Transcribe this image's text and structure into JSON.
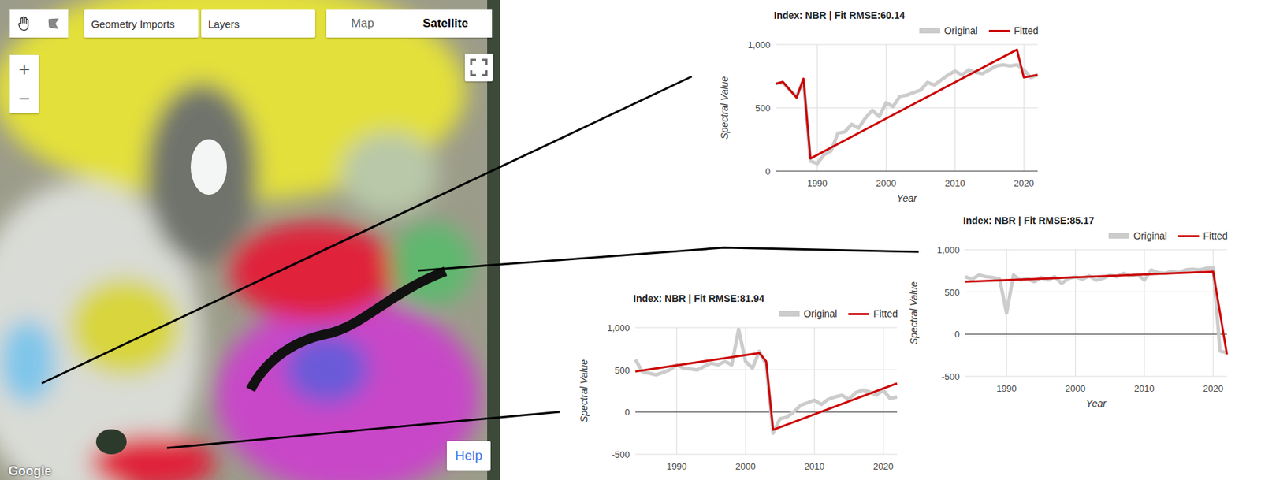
{
  "map": {
    "geometry_imports": "Geometry Imports",
    "layers": "Layers",
    "map_types": [
      {
        "label": "Map",
        "selected": false
      },
      {
        "label": "Satellite",
        "selected": true
      }
    ],
    "zoom": [
      "+",
      "−"
    ],
    "help": "Help",
    "attribution": "Google"
  },
  "charts": [
    {
      "title": "Index: NBR | Fit RMSE:60.14",
      "legend": {
        "original": "Original",
        "fitted": "Fitted"
      },
      "y_label": "Spectral Value",
      "x_label": "Year",
      "y_min": 0,
      "y_max": 1000,
      "y_ticks": [
        {
          "label": "0",
          "value": 0
        },
        {
          "label": "500",
          "value": 500
        },
        {
          "label": "1,000",
          "value": 1000
        }
      ],
      "x_ticks": [
        {
          "label": "1990",
          "value": 1990
        },
        {
          "label": "2000",
          "value": 2000
        },
        {
          "label": "2010",
          "value": 2010
        },
        {
          "label": "2020",
          "value": 2020
        }
      ],
      "original": {
        "start_year": 1984,
        "values": [
          690,
          700,
          640,
          590,
          720,
          80,
          60,
          130,
          160,
          300,
          310,
          370,
          340,
          420,
          480,
          430,
          540,
          510,
          590,
          600,
          620,
          640,
          700,
          680,
          720,
          760,
          790,
          760,
          800,
          780,
          770,
          800,
          830,
          840,
          830,
          840,
          800,
          740,
          760
        ]
      },
      "fitted": {
        "years": [
          1984,
          1985,
          1987,
          1988,
          1989,
          2019,
          2020,
          2022
        ],
        "values": [
          690,
          705,
          580,
          730,
          100,
          960,
          740,
          760
        ]
      }
    },
    {
      "title": "Index: NBR | Fit RMSE:85.17",
      "legend": {
        "original": "Original",
        "fitted": "Fitted"
      },
      "y_label": "Spectral Value",
      "x_label": "Year",
      "y_min": -500,
      "y_max": 1000,
      "y_ticks": [
        {
          "label": "-500",
          "value": -500
        },
        {
          "label": "0",
          "value": 0
        },
        {
          "label": "500",
          "value": 500
        },
        {
          "label": "1,000",
          "value": 1000
        }
      ],
      "x_ticks": [
        {
          "label": "1990",
          "value": 1990
        },
        {
          "label": "2000",
          "value": 2000
        },
        {
          "label": "2010",
          "value": 2010
        },
        {
          "label": "2020",
          "value": 2020
        }
      ],
      "original": {
        "start_year": 1984,
        "values": [
          680,
          650,
          700,
          680,
          670,
          650,
          250,
          700,
          640,
          660,
          620,
          670,
          640,
          680,
          600,
          660,
          680,
          650,
          690,
          640,
          660,
          700,
          680,
          720,
          690,
          710,
          640,
          760,
          730,
          720,
          740,
          730,
          760,
          770,
          760,
          780,
          790,
          -200,
          -220
        ]
      },
      "fitted": {
        "years": [
          1984,
          2020,
          2022
        ],
        "values": [
          620,
          740,
          -240
        ]
      }
    },
    {
      "title": "Index: NBR | Fit RMSE:81.94",
      "legend": {
        "original": "Original",
        "fitted": "Fitted"
      },
      "y_label": "Spectral Value",
      "y_min": -500,
      "y_max": 1000,
      "y_ticks": [
        {
          "label": "-500",
          "value": -500
        },
        {
          "label": "0",
          "value": 0
        },
        {
          "label": "500",
          "value": 500
        },
        {
          "label": "1,000",
          "value": 1000
        }
      ],
      "x_ticks": [
        {
          "label": "1990",
          "value": 1990
        },
        {
          "label": "2000",
          "value": 2000
        },
        {
          "label": "2010",
          "value": 2010
        },
        {
          "label": "2020",
          "value": 2020
        }
      ],
      "original": {
        "start_year": 1984,
        "values": [
          620,
          480,
          460,
          440,
          470,
          500,
          560,
          520,
          510,
          500,
          540,
          580,
          560,
          600,
          560,
          980,
          600,
          520,
          720,
          560,
          -250,
          -80,
          -60,
          0,
          80,
          110,
          140,
          90,
          150,
          180,
          200,
          150,
          230,
          260,
          240,
          200,
          260,
          160,
          180
        ]
      },
      "fitted": {
        "years": [
          1984,
          2002,
          2003,
          2004,
          2022
        ],
        "values": [
          480,
          700,
          600,
          -210,
          340
        ]
      }
    }
  ]
}
